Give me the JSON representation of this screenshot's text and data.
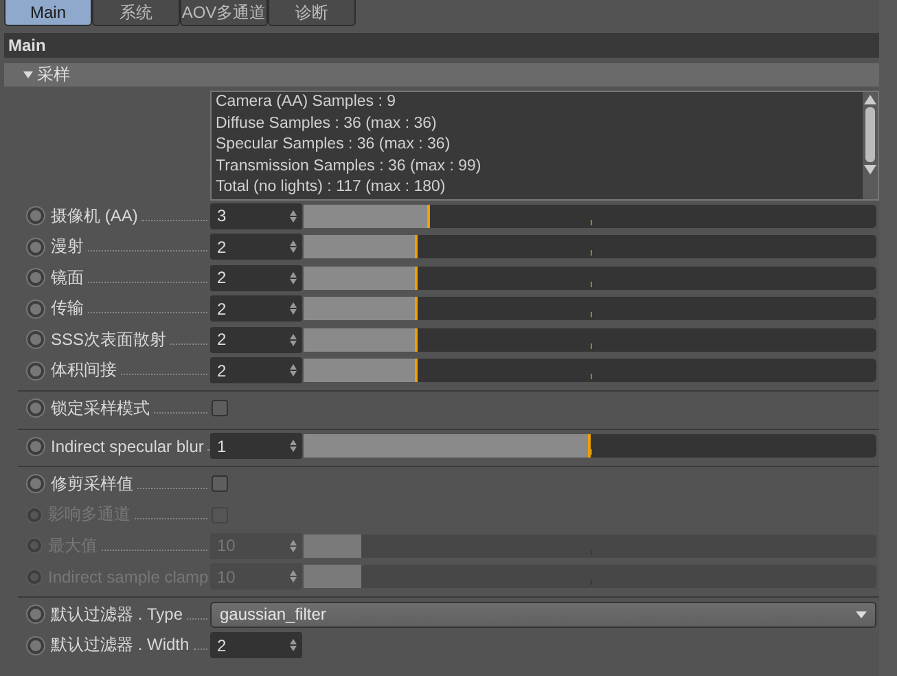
{
  "tabs": [
    {
      "label": "Main",
      "selected": true
    },
    {
      "label": "系统",
      "selected": false
    },
    {
      "label": "AOV多通道",
      "selected": false
    },
    {
      "label": "诊断",
      "selected": false
    }
  ],
  "panel_title": "Main",
  "section": {
    "label": "采样",
    "expanded": true
  },
  "info_lines": [
    "Camera (AA) Samples : 9",
    "Diffuse Samples : 36 (max : 36)",
    "Specular Samples : 36 (max : 36)",
    "Transmission Samples : 36 (max : 99)",
    "Total (no lights) : 117 (max : 180)"
  ],
  "groups": [
    {
      "rows": [
        {
          "kind": "slider",
          "label": "摄像机 (AA)",
          "value": "3",
          "level": 0.22,
          "disabled": false
        },
        {
          "kind": "slider",
          "label": "漫射",
          "value": "2",
          "level": 0.2,
          "disabled": false
        },
        {
          "kind": "slider",
          "label": "镜面",
          "value": "2",
          "level": 0.2,
          "disabled": false
        },
        {
          "kind": "slider",
          "label": "传输",
          "value": "2",
          "level": 0.2,
          "disabled": false
        },
        {
          "kind": "slider",
          "label": "SSS次表面散射",
          "value": "2",
          "level": 0.2,
          "disabled": false
        },
        {
          "kind": "slider",
          "label": "体积间接",
          "value": "2",
          "level": 0.2,
          "disabled": false
        }
      ]
    },
    {
      "rows": [
        {
          "kind": "checkbox",
          "label": "锁定采样模式",
          "checked": false,
          "disabled": false
        }
      ]
    },
    {
      "rows": [
        {
          "kind": "slider",
          "label": "Indirect specular blur",
          "value": "1",
          "level": 0.5,
          "disabled": false
        }
      ]
    },
    {
      "rows": [
        {
          "kind": "checkbox",
          "label": "修剪采样值",
          "checked": false,
          "disabled": false
        },
        {
          "kind": "checkbox",
          "label": "影响多通道",
          "checked": false,
          "disabled": true
        },
        {
          "kind": "slider",
          "label": "最大值",
          "value": "10",
          "level": 0.1,
          "disabled": true
        },
        {
          "kind": "slider",
          "label": "Indirect sample clamp",
          "value": "10",
          "level": 0.1,
          "disabled": true
        }
      ]
    },
    {
      "rows": [
        {
          "kind": "dropdown",
          "label": "默认过滤器 . Type",
          "value": "gaussian_filter",
          "disabled": false
        },
        {
          "kind": "number",
          "label": "默认过滤器 . Width",
          "value": "2",
          "disabled": false
        }
      ]
    }
  ]
}
